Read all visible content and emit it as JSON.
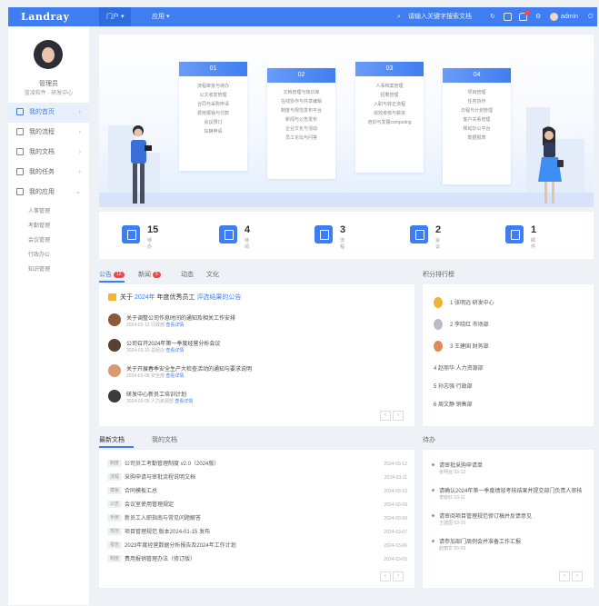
{
  "app": {
    "logo": "Landray"
  },
  "topnav": [
    {
      "label": "门户 ▾",
      "active": true
    },
    {
      "label": "应用 ▾",
      "active": false
    }
  ],
  "topbar_right": {
    "search": "请输入关键字搜索文档",
    "user": "admin"
  },
  "sidebar": {
    "profile": {
      "name": "管理员",
      "dept": "蓝凌软件 · 研发中心"
    },
    "menu": [
      {
        "label": "我的首页",
        "active": true
      },
      {
        "label": "我的流程"
      },
      {
        "label": "我的文档"
      },
      {
        "label": "我的任务"
      },
      {
        "label": "我的应用",
        "expanded": true
      }
    ],
    "submenu": [
      "人事管理",
      "考勤管理",
      "会议管理",
      "行政办公",
      "知识管理"
    ]
  },
  "banner": {
    "cards": [
      {
        "title": "01",
        "lines": [
          "流程审批与待办",
          "公文收发管理",
          "合同与采购申请",
          "费用报销与付款",
          "会议预订",
          "车辆申请"
        ]
      },
      {
        "title": "02",
        "lines": [
          "文档管理与知识库",
          "在线协作与共享编辑",
          "制度与规范发布平台",
          "新闻与公告发布",
          "企业文化与活动",
          "员工论坛与问答"
        ]
      },
      {
        "title": "03",
        "lines": [
          "人事档案管理",
          "招聘管理",
          "入职与转正流程",
          "绩效考核与薪资",
          "培训与发展computing"
        ]
      },
      {
        "title": "04",
        "lines": [
          "项目管理",
          "任务协作",
          "日程与计划管理",
          "客户关系管理",
          "移动办公平台",
          "数据报表"
        ]
      }
    ]
  },
  "stats": [
    {
      "num": "15",
      "label": "待办"
    },
    {
      "num": "4",
      "label": "待阅"
    },
    {
      "num": "3",
      "label": "流程"
    },
    {
      "num": "2",
      "label": "会议"
    },
    {
      "num": "1",
      "label": "邮件"
    }
  ],
  "news_tabs": [
    {
      "label": "公告",
      "count": "12",
      "active": true
    },
    {
      "label": "新闻",
      "count": "5"
    },
    {
      "label": "动态"
    },
    {
      "label": "文化"
    }
  ],
  "announcement": {
    "prefix": "关于",
    "highlight": "2024年",
    "middle": "年度优秀员工",
    "suffix": "评选结果的公告"
  },
  "news_items": [
    {
      "title": "关于调整公司作息时间的通知及相关工作安排",
      "meta": "2024-03-12  行政部  ",
      "link": "查看详情"
    },
    {
      "title": "公司召开2024年第一季度经营分析会议",
      "meta": "2024-03-10  总经办  ",
      "link": "查看详情"
    },
    {
      "title": "关于开展春季安全生产大检查活动的通知与要求说明",
      "meta": "2024-03-08  安全部  ",
      "link": "查看详情"
    },
    {
      "title": "研发中心新员工培训计划",
      "meta": "2024-03-05  人力资源部  ",
      "link": "查看详情"
    }
  ],
  "ranking": {
    "title": "积分排行榜",
    "items": [
      "1  张明远  研发中心",
      "2  李晓红  市场部",
      "3  王建国  财务部",
      "4  赵丽华  人力资源部",
      "5  孙志强  行政部",
      "6  周文静  销售部"
    ]
  },
  "docs": {
    "tabs": [
      "最新文档",
      "我的文档"
    ],
    "rows": [
      {
        "tag": "制度",
        "title": "公司员工考勤管理制度 v2.0（2024版）",
        "date": "2024-03-12"
      },
      {
        "tag": "流程",
        "title": "采购申请与审批流程说明文档",
        "date": "2024-03-11"
      },
      {
        "tag": "模板",
        "title": "合同模板汇总",
        "date": "2024-03-10"
      },
      {
        "tag": "公告",
        "title": "会议室使用管理规定",
        "date": "2024-03-09"
      },
      {
        "tag": "手册",
        "title": "新员工入职指南与常见问题解答",
        "date": "2024-03-08"
      },
      {
        "tag": "规范",
        "title": "项目管理规范  版本2024-01-15  发布",
        "date": "2024-03-07"
      },
      {
        "tag": "报告",
        "title": "2023年度经营数据分析报告及2024年工作计划",
        "date": "2024-03-06"
      },
      {
        "tag": "制度",
        "title": "费用报销管理办法（修订版）",
        "date": "2024-03-05"
      }
    ]
  },
  "todos": {
    "title": "待办",
    "items": [
      {
        "title": "请审批采购申请单",
        "sub": "张明远  03-12"
      },
      {
        "title": "请确认2024年第一季度绩效考核结果并提交部门负责人审核",
        "sub": "李晓红  03-11"
      },
      {
        "title": "请审阅项目管理规范修订稿并反馈意见",
        "sub": "王建国  03-10"
      },
      {
        "title": "请参加部门周例会并准备工作汇报",
        "sub": "赵丽华  03-09"
      }
    ]
  }
}
